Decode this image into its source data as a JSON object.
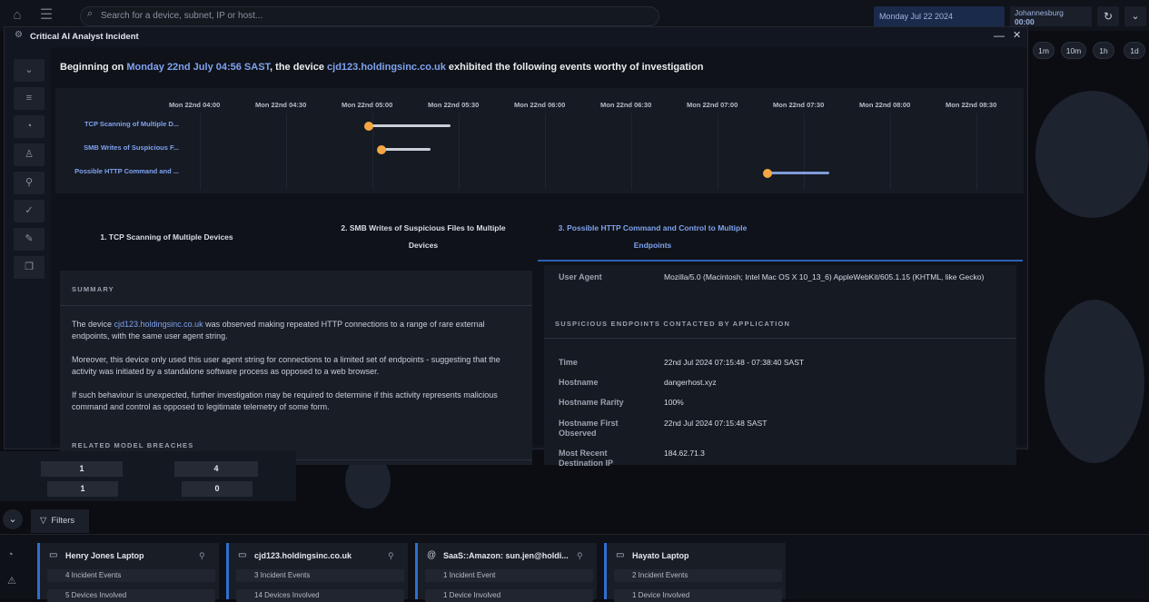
{
  "topbar": {
    "search_placeholder": "Search for a device, subnet, IP or host...",
    "date": "Monday Jul 22 2024",
    "timezone_city": "Johannesburg",
    "timezone_time": "00:00",
    "time_buttons": [
      "1m",
      "10m",
      "1h",
      "1d"
    ]
  },
  "modal": {
    "title": "Critical AI Analyst Incident",
    "headline": {
      "prefix": "Beginning on ",
      "date": "Monday 22nd July 04:56 SAST",
      "middle": ", the device ",
      "device": "cjd123.holdingsinc.co.uk",
      "suffix": " exhibited the following events worthy of investigation"
    },
    "timeline": {
      "ticks": [
        "Mon 22nd 04:00",
        "Mon 22nd 04:30",
        "Mon 22nd 05:00",
        "Mon 22nd 05:30",
        "Mon 22nd 06:00",
        "Mon 22nd 06:30",
        "Mon 22nd 07:00",
        "Mon 22nd 07:30",
        "Mon 22nd 08:00",
        "Mon 22nd 08:30"
      ],
      "events": [
        {
          "label": "TCP Scanning of Multiple D..."
        },
        {
          "label": "SMB Writes of Suspicious F..."
        },
        {
          "label": "Possible HTTP Command and ..."
        }
      ]
    },
    "tabs": {
      "tab1": "1. TCP Scanning of Multiple Devices",
      "tab2_line1": "2. SMB Writes of Suspicious Files to Multiple",
      "tab2_line2": "Devices",
      "tab3_line1": "3. Possible HTTP Command and Control to Multiple",
      "tab3_line2": "Endpoints"
    },
    "summary": {
      "heading": "SUMMARY",
      "p1_prefix": "The device ",
      "p1_device": "cjd123.holdingsinc.co.uk",
      "p1_suffix": " was observed making repeated HTTP connections to a range of rare external endpoints, with the same user agent string.",
      "p2": "Moreover, this device only used this user agent string for connections to a limited set of endpoints - suggesting that the activity was initiated by a standalone software process as opposed to a web browser.",
      "p3": "If such behaviour is unexpected, further investigation may be required to determine if this activity represents malicious command and control as opposed to legitimate telemetry of some form.",
      "breaches_heading": "RELATED MODEL BREACHES"
    },
    "details": {
      "user_agent_key": "User Agent",
      "user_agent_value": "Mozilla/5.0 (Macintosh; Intel Mac OS X 10_13_6) AppleWebKit/605.1.15 (KHTML, like Gecko)",
      "endpoints_heading": "SUSPICIOUS ENDPOINTS CONTACTED BY APPLICATION",
      "rows": [
        {
          "key": "Time",
          "value": "22nd Jul 2024 07:15:48 - 07:38:40 SAST"
        },
        {
          "key": "Hostname",
          "value": "dangerhost.xyz"
        },
        {
          "key": "Hostname Rarity",
          "value": "100%"
        },
        {
          "key": "Hostname First Observed",
          "value": "22nd Jul 2024 07:15:48 SAST"
        },
        {
          "key": "Most Recent Destination IP",
          "value": "184.62.71.3"
        }
      ]
    }
  },
  "stats": [
    "1",
    "1",
    "4",
    "0"
  ],
  "filters_label": "Filters",
  "cards": [
    {
      "title": "Henry Jones Laptop",
      "row1": "4 Incident Events",
      "row2": "5 Devices Involved"
    },
    {
      "title": "cjd123.holdingsinc.co.uk",
      "row1": "3 Incident Events",
      "row2": "14 Devices Involved"
    },
    {
      "title": "SaaS::Amazon: sun.jen@holdi...",
      "row1": "1 Incident Event",
      "row2": "1 Device Involved"
    },
    {
      "title": "Hayato Laptop",
      "row1": "2 Incident Events",
      "row2": "1 Device Involved"
    }
  ]
}
